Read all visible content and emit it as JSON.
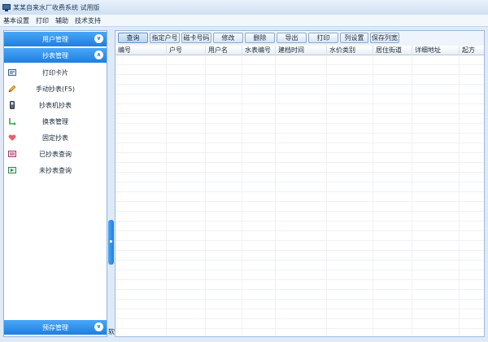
{
  "window": {
    "title": "某某自来水厂收费系统 试用版"
  },
  "menu": [
    "基本设置",
    "打印",
    "辅助",
    "技术支持"
  ],
  "sidebar": {
    "groups": [
      {
        "label": "用户管理",
        "icon": "chevron-down-icon"
      },
      {
        "label": "抄表管理",
        "icon": "chevron-up-icon"
      },
      {
        "label": "预存管理",
        "icon": "chevron-down-icon"
      }
    ],
    "items": [
      {
        "label": "打印卡片",
        "icon": "card-icon"
      },
      {
        "label": "手动抄表(F5)",
        "icon": "pencil-icon"
      },
      {
        "label": "抄表机抄表",
        "icon": "handheld-device-icon"
      },
      {
        "label": "换表管理",
        "icon": "swap-icon"
      },
      {
        "label": "固定抄表",
        "icon": "heart-icon"
      },
      {
        "label": "已抄表查询",
        "icon": "list-check-icon"
      },
      {
        "label": "未抄表查询",
        "icon": "list-arrow-icon"
      }
    ]
  },
  "splitter": {
    "label": "软"
  },
  "toolbar": {
    "buttons": [
      "查询",
      "指定户号",
      "磁卡号码",
      "修改",
      "删除",
      "导出",
      "打印",
      "列设置",
      "保存列宽"
    ]
  },
  "grid": {
    "columns": [
      "编号",
      "户号",
      "用户名",
      "水表编号",
      "建档时间",
      "水价类别",
      "居住街道",
      "详细地址",
      "起方"
    ]
  },
  "colors": {
    "accent": "#1f7ee0",
    "accent_light": "#4aa7f6",
    "border": "#8fb4dc"
  }
}
